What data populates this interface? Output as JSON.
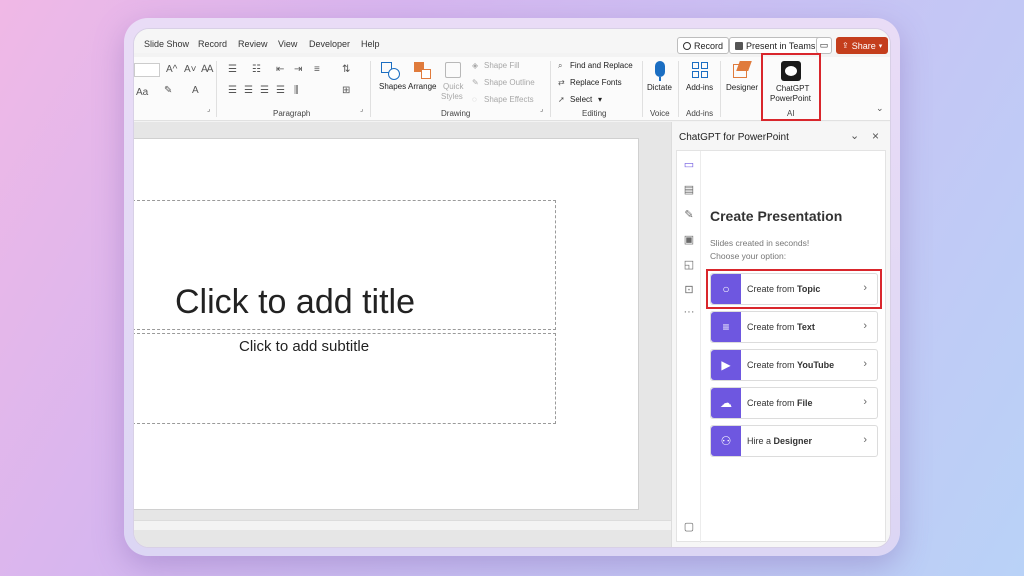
{
  "tabs": [
    "Slide Show",
    "Record",
    "Review",
    "View",
    "Developer",
    "Help"
  ],
  "top_buttons": {
    "record": "Record",
    "present_in_teams": "Present in Teams",
    "share": "Share"
  },
  "ribbon": {
    "font_glyphs": {
      "grow": "A^",
      "shrink": "A˅",
      "clear": "Aa"
    },
    "paragraph_label": "Paragraph",
    "drawing": {
      "label": "Drawing",
      "shapes": "Shapes",
      "arrange": "Arrange",
      "quick_styles_1": "Quick",
      "quick_styles_2": "Styles",
      "shape_fill": "Shape Fill",
      "shape_outline": "Shape Outline",
      "shape_effects": "Shape Effects"
    },
    "editing": {
      "label": "Editing",
      "find_replace": "Find and Replace",
      "replace_fonts": "Replace Fonts",
      "select": "Select"
    },
    "voice": {
      "label": "Voice",
      "dictate": "Dictate"
    },
    "addins": {
      "label": "Add-ins",
      "addins": "Add-ins"
    },
    "designer": "Designer",
    "ai": {
      "label": "AI",
      "chatgpt_1": "ChatGPT",
      "chatgpt_2": "PowerPoint"
    }
  },
  "slide": {
    "title_placeholder": "Click to add title",
    "subtitle_placeholder": "Click to add subtitle"
  },
  "pane": {
    "title": "ChatGPT for PowerPoint",
    "heading": "Create Presentation",
    "sub1": "Slides created in seconds!",
    "sub2": "Choose your option:",
    "options": [
      {
        "prefix": "Create from ",
        "bold": "Topic",
        "icon": "lightbulb-icon"
      },
      {
        "prefix": "Create from ",
        "bold": "Text",
        "icon": "text-lines-icon"
      },
      {
        "prefix": "Create from ",
        "bold": "YouTube",
        "icon": "video-icon"
      },
      {
        "prefix": "Create from ",
        "bold": "File",
        "icon": "cloud-upload-icon"
      },
      {
        "prefix": "Hire a ",
        "bold": "Designer",
        "icon": "people-icon"
      }
    ]
  },
  "colors": {
    "accent": "#6e57e0",
    "highlight": "#d9262c",
    "share": "#c43e1c"
  }
}
